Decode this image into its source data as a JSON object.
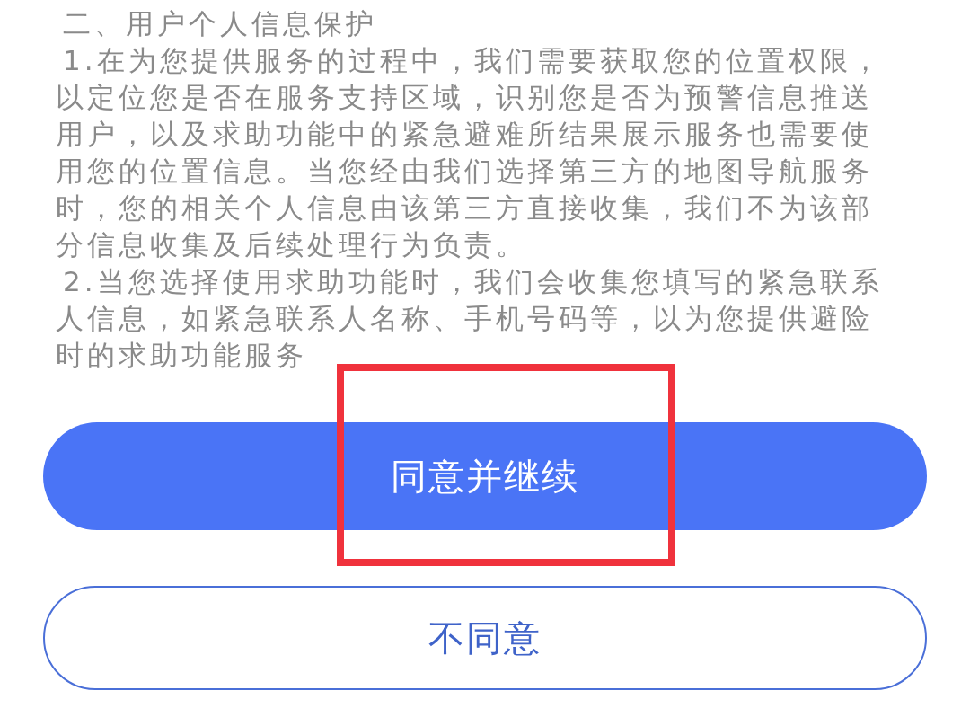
{
  "policy": {
    "heading": "二、用户个人信息保护",
    "paragraphs": [
      "1.在为您提供服务的过程中，我们需要获取您的位置权限，以定位您是否在服务支持区域，识别您是否为预警信息推送用户，以及求助功能中的紧急避难所结果展示服务也需要使用您的位置信息。当您经由我们选择第三方的地图导航服务时，您的相关个人信息由该第三方直接收集，我们不为该部分信息收集及后续处理行为负责。",
      "2.当您选择使用求助功能时，我们会收集您填写的紧急联系人信息，如紧急联系人名称、手机号码等，以为您提供避险时的求助功能服务"
    ]
  },
  "buttons": [
    {
      "kind": "primary",
      "label": "同意并继续",
      "highlighted": true
    },
    {
      "kind": "outline",
      "label": "不同意",
      "highlighted": false
    }
  ]
}
